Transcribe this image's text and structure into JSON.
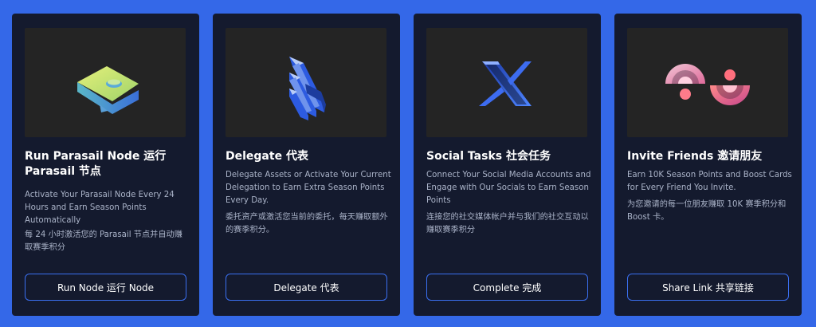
{
  "cards": [
    {
      "title": "Run Parasail Node  运行 Parasail 节点",
      "desc_en": "Activate Your Parasail Node Every 24 Hours and Earn Season Points Automatically",
      "desc_zh": "每 24 小时激活您的 Parasail 节点并自动赚取赛季积分",
      "button": "Run Node  运行 Node",
      "icon": "parasail-node-icon"
    },
    {
      "title": "Delegate  代表",
      "desc_en": "Delegate Assets or Activate Your Current Delegation to Earn Extra Season Points Every Day.",
      "desc_zh": "委托资产或激活您当前的委托，每天赚取额外的赛季积分。",
      "button": "Delegate  代表",
      "icon": "delegate-icon"
    },
    {
      "title": "Social Tasks  社会任务",
      "desc_en": "Connect Your Social Media Accounts and Engage with Our Socials to Earn Season Points",
      "desc_zh": "连接您的社交媒体帐户并与我们的社交互动以赚取赛季积分",
      "button": "Complete  完成",
      "icon": "x-logo-icon"
    },
    {
      "title": "Invite Friends  邀请朋友",
      "desc_en": "Earn 10K Season Points and Boost Cards for Every Friend You Invite.",
      "desc_zh": "为您邀请的每一位朋友赚取 10K 赛季积分和 Boost 卡。",
      "button": "Share Link  共享链接",
      "icon": "invite-friends-icon"
    }
  ],
  "colors": {
    "background": "#3468e8",
    "card": "#141a2e",
    "media": "#242424",
    "accent": "#3a6ff0",
    "text": "#ffffff",
    "muted": "#aab3c8"
  }
}
